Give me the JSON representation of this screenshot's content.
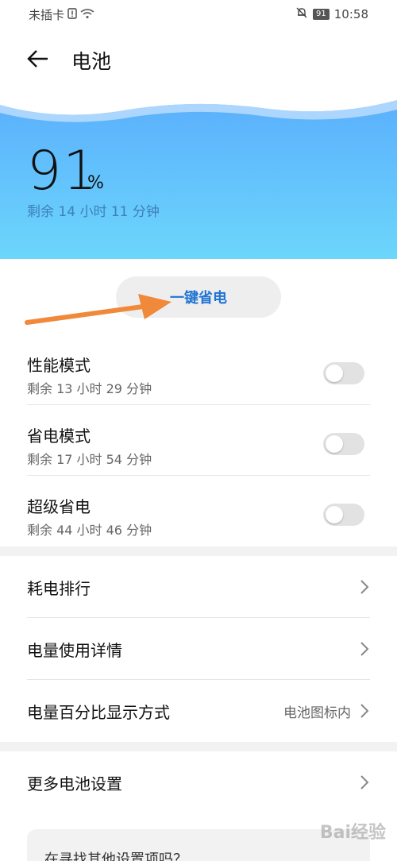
{
  "status_bar": {
    "carrier": "未插卡",
    "battery_level": "91",
    "time": "10:58",
    "icons": [
      "sim-alert-icon",
      "wifi-icon",
      "mute-bell-icon",
      "battery-icon"
    ]
  },
  "header": {
    "back_icon": "back-arrow-icon",
    "title": "电池"
  },
  "hero": {
    "percent": "91",
    "percent_sign": "%",
    "remaining": "剩余 14 小时 11 分钟",
    "colors": {
      "top": "#5aaefc",
      "bottom": "#6cd6fb"
    }
  },
  "one_key_save": {
    "label": "一键省电",
    "accent": "#1f74d3",
    "arrow_color": "#f0893a"
  },
  "modes": [
    {
      "title": "性能模式",
      "subtitle": "剩余 13 小时 29 分钟",
      "enabled": false
    },
    {
      "title": "省电模式",
      "subtitle": "剩余 17 小时 54 分钟",
      "enabled": false
    },
    {
      "title": "超级省电",
      "subtitle": "剩余 44 小时 46 分钟",
      "enabled": false
    }
  ],
  "nav_items": [
    {
      "label": "耗电排行",
      "value": ""
    },
    {
      "label": "电量使用详情",
      "value": ""
    },
    {
      "label": "电量百分比显示方式",
      "value": "电池图标内"
    }
  ],
  "more_settings": {
    "label": "更多电池设置"
  },
  "search_card": {
    "text": "在寻找其他设置项吗？"
  },
  "watermark": {
    "text": "Bai经验"
  }
}
